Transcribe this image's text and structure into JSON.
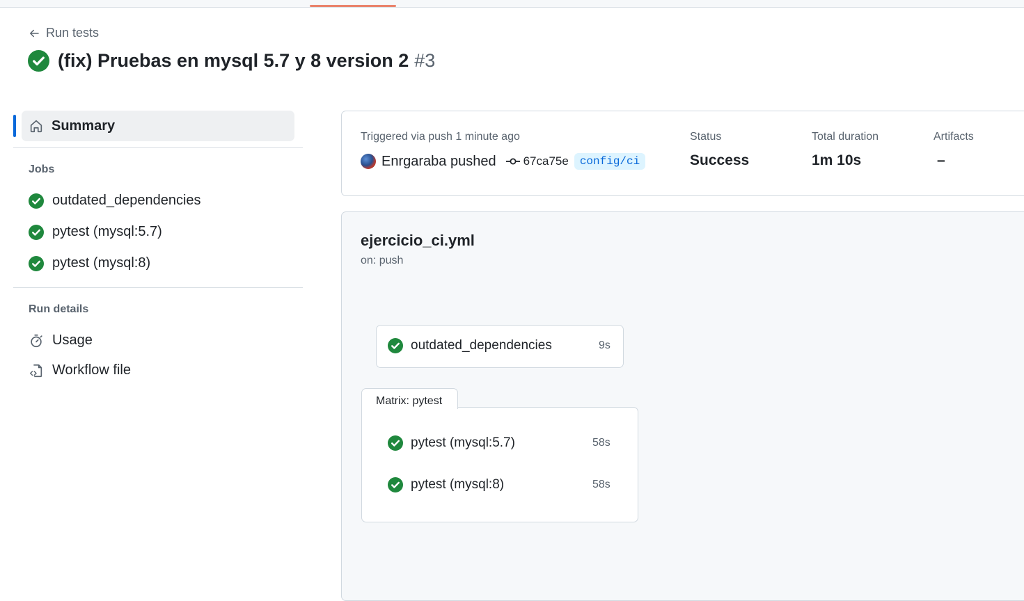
{
  "header": {
    "back_label": "Run tests",
    "title": "(fix) Pruebas en mysql 5.7 y 8 version 2",
    "run_number": "#3"
  },
  "sidebar": {
    "summary_label": "Summary",
    "jobs_heading": "Jobs",
    "jobs": [
      {
        "label": "outdated_dependencies",
        "status": "success"
      },
      {
        "label": "pytest (mysql:5.7)",
        "status": "success"
      },
      {
        "label": "pytest (mysql:8)",
        "status": "success"
      }
    ],
    "run_details_heading": "Run details",
    "details": [
      {
        "label": "Usage",
        "icon": "stopwatch-icon"
      },
      {
        "label": "Workflow file",
        "icon": "file-code-icon"
      }
    ]
  },
  "summary": {
    "trigger_text": "Triggered via push 1 minute ago",
    "actor": "Enrgaraba pushed",
    "commit_sha": "67ca75e",
    "branch": "config/ci",
    "status_label": "Status",
    "status_value": "Success",
    "duration_label": "Total duration",
    "duration_value": "1m 10s",
    "artifacts_label": "Artifacts",
    "artifacts_value": "–"
  },
  "workflow": {
    "file_name": "ejercicio_ci.yml",
    "trigger": "on: push",
    "standalone_job": {
      "label": "outdated_dependencies",
      "duration": "9s"
    },
    "matrix": {
      "label": "Matrix: pytest",
      "jobs": [
        {
          "label": "pytest (mysql:5.7)",
          "duration": "58s"
        },
        {
          "label": "pytest (mysql:8)",
          "duration": "58s"
        }
      ]
    }
  },
  "colors": {
    "success": "#1f883d",
    "accent": "#0969da",
    "muted": "#59636e"
  }
}
